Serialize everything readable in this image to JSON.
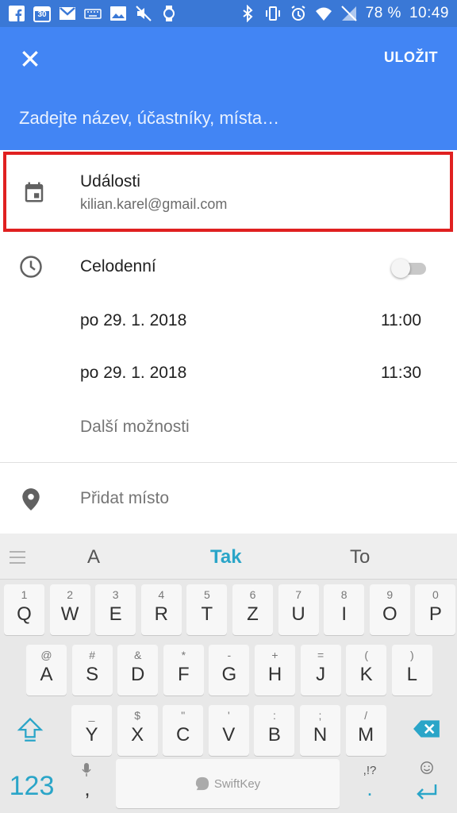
{
  "status_bar": {
    "battery": "78 %",
    "time": "10:49",
    "calendar_badge": "30"
  },
  "app_bar": {
    "save_label": "ULOŽIT",
    "title_placeholder": "Zadejte název, účastníky, místa…"
  },
  "calendar": {
    "name": "Události",
    "account": "kilian.karel@gmail.com"
  },
  "event": {
    "all_day_label": "Celodenní",
    "all_day_enabled": false,
    "start_date": "po 29. 1. 2018",
    "start_time": "11:00",
    "end_date": "po 29. 1. 2018",
    "end_time": "11:30",
    "more_options": "Další možnosti",
    "add_location": "Přidat místo"
  },
  "keyboard": {
    "suggestions": [
      "A",
      "Tak",
      "To"
    ],
    "row1": [
      {
        "hint": "1",
        "key": "Q"
      },
      {
        "hint": "2",
        "key": "W"
      },
      {
        "hint": "3",
        "key": "E"
      },
      {
        "hint": "4",
        "key": "R"
      },
      {
        "hint": "5",
        "key": "T"
      },
      {
        "hint": "6",
        "key": "Z"
      },
      {
        "hint": "7",
        "key": "U"
      },
      {
        "hint": "8",
        "key": "I"
      },
      {
        "hint": "9",
        "key": "O"
      },
      {
        "hint": "0",
        "key": "P"
      }
    ],
    "row2": [
      {
        "hint": "@",
        "key": "A"
      },
      {
        "hint": "#",
        "key": "S"
      },
      {
        "hint": "&",
        "key": "D"
      },
      {
        "hint": "*",
        "key": "F"
      },
      {
        "hint": "-",
        "key": "G"
      },
      {
        "hint": "+",
        "key": "H"
      },
      {
        "hint": "=",
        "key": "J"
      },
      {
        "hint": "(",
        "key": "K"
      },
      {
        "hint": ")",
        "key": "L"
      }
    ],
    "row3": [
      {
        "hint": "_",
        "key": "Y"
      },
      {
        "hint": "$",
        "key": "X"
      },
      {
        "hint": "\"",
        "key": "C"
      },
      {
        "hint": "'",
        "key": "V"
      },
      {
        "hint": ":",
        "key": "B"
      },
      {
        "hint": ";",
        "key": "N"
      },
      {
        "hint": "/",
        "key": "M"
      }
    ],
    "num_label": "123",
    "comma": ",",
    "space_brand": "SwiftKey",
    "punct_top": ",!?",
    "punct_main": ".",
    "accent_color": "#2aa5c8"
  },
  "colors": {
    "header": "#4285f4",
    "highlight_border": "#e02020"
  }
}
